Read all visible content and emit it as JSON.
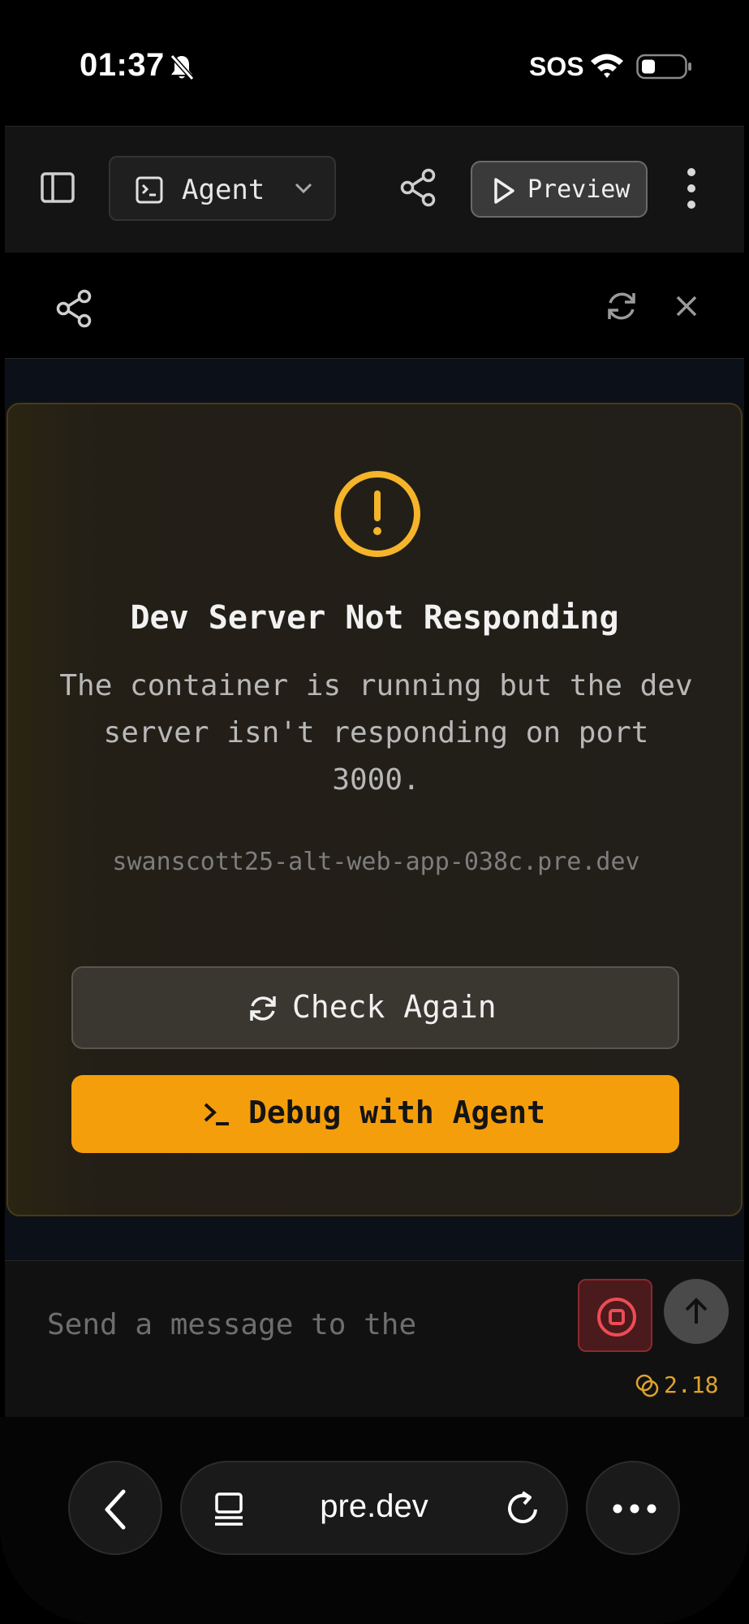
{
  "status_bar": {
    "time": "01:37",
    "carrier": "SOS",
    "icons": [
      "bell-slash-icon",
      "wifi-icon",
      "battery-icon"
    ]
  },
  "toolbar": {
    "mode_label": "Agent",
    "preview_label": "Preview",
    "icons": [
      "sidebar-toggle-icon",
      "terminal-icon",
      "chevron-down-icon",
      "share-icon",
      "play-icon",
      "more-vertical-icon"
    ]
  },
  "preview_toolbar": {
    "icons": [
      "share-icon",
      "refresh-icon",
      "close-icon"
    ]
  },
  "error_card": {
    "title": "Dev Server Not Responding",
    "description": "The container is running but the dev server isn't responding on port 3000.",
    "host": "swanscott25-alt-web-app-038c.pre.dev",
    "check_again_label": "Check Again",
    "debug_label": "Debug with Agent",
    "icons": [
      "warning-circle-icon",
      "refresh-icon",
      "terminal-prompt-icon"
    ],
    "accent_color": "#f59e0b"
  },
  "composer": {
    "placeholder": "Send a message to the",
    "credits": "2.18",
    "icons": [
      "stop-icon",
      "arrow-up-icon",
      "coins-icon"
    ]
  },
  "browser_bar": {
    "url": "pre.dev",
    "icons": [
      "back-icon",
      "tabs-icon",
      "reload-icon",
      "more-horizontal-icon"
    ]
  }
}
